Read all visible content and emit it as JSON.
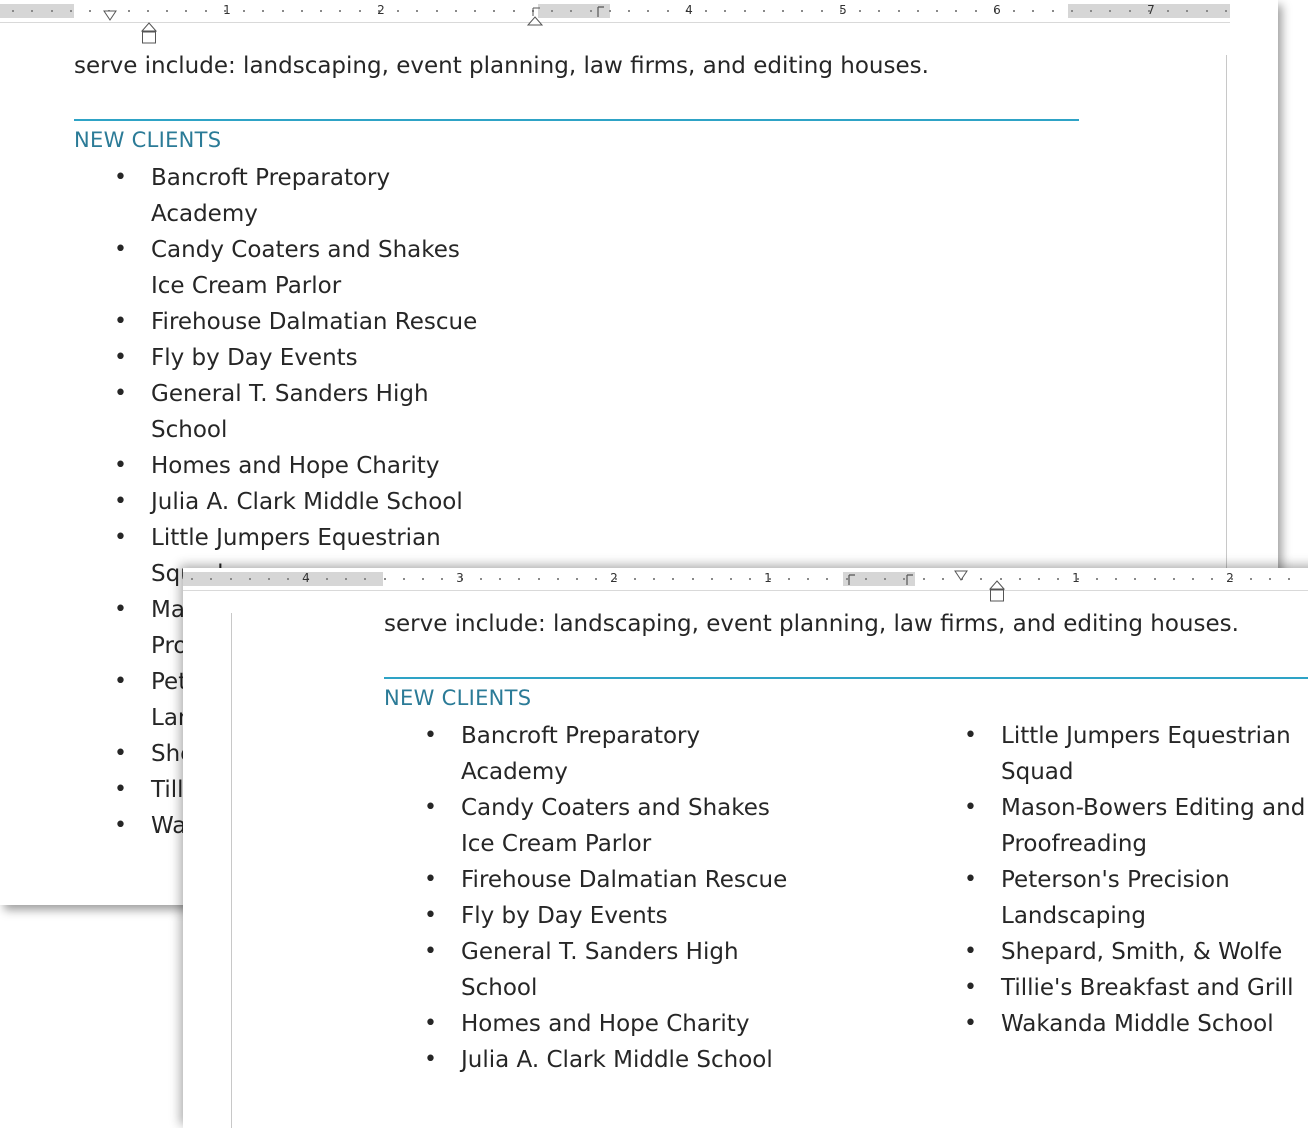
{
  "ruler_top": {
    "labels": [
      "1",
      "2",
      "4",
      "5",
      "6",
      "7"
    ]
  },
  "ruler_bottom": {
    "labels": [
      "4",
      "3",
      "2",
      "1",
      "1",
      "2"
    ]
  },
  "intro_text": "serve include: landscaping, event planning, law firms, and editing houses.",
  "section_heading": "NEW CLIENTS",
  "clients_single_column": [
    [
      "Bancroft Preparatory",
      "Academy"
    ],
    [
      "Candy Coaters and Shakes",
      "Ice Cream Parlor"
    ],
    [
      "Firehouse Dalmatian Rescue"
    ],
    [
      "Fly by Day Events"
    ],
    [
      "General T. Sanders High",
      "School"
    ],
    [
      "Homes and Hope Charity"
    ],
    [
      "Julia A. Clark Middle School"
    ],
    [
      "Little Jumpers Equestrian",
      "Squad"
    ],
    [
      "Mason-Bowers Editing and",
      "Proofreading"
    ],
    [
      "Peterson's Precision",
      "Landscaping"
    ],
    [
      "Shepard, Smith, & Wolfe"
    ],
    [
      "Tillie's Breakfast and Grill"
    ],
    [
      "Wakanda Middle School"
    ]
  ],
  "clients_two_column": {
    "left": [
      [
        "Bancroft Preparatory",
        "Academy"
      ],
      [
        "Candy Coaters and Shakes",
        "Ice Cream Parlor"
      ],
      [
        "Firehouse Dalmatian Rescue"
      ],
      [
        "Fly by Day Events"
      ],
      [
        "General T. Sanders High",
        "School"
      ],
      [
        "Homes and Hope Charity"
      ],
      [
        "Julia A. Clark Middle School"
      ]
    ],
    "right": [
      [
        "Little Jumpers Equestrian",
        "Squad"
      ],
      [
        "Mason-Bowers Editing and",
        "Proofreading"
      ],
      [
        "Peterson's Precision",
        "Landscaping"
      ],
      [
        "Shepard, Smith, & Wolfe"
      ],
      [
        "Tillie's Breakfast and Grill"
      ],
      [
        "Wakanda Middle School"
      ]
    ]
  },
  "colors": {
    "heading": "#2b7b97",
    "rule": "#2ea3c6",
    "text": "#262626",
    "ruler_gray": "#d6d6d6"
  },
  "icons": [
    "first-line-indent-marker-icon",
    "hanging-indent-marker-icon",
    "left-tab-stop-icon"
  ]
}
